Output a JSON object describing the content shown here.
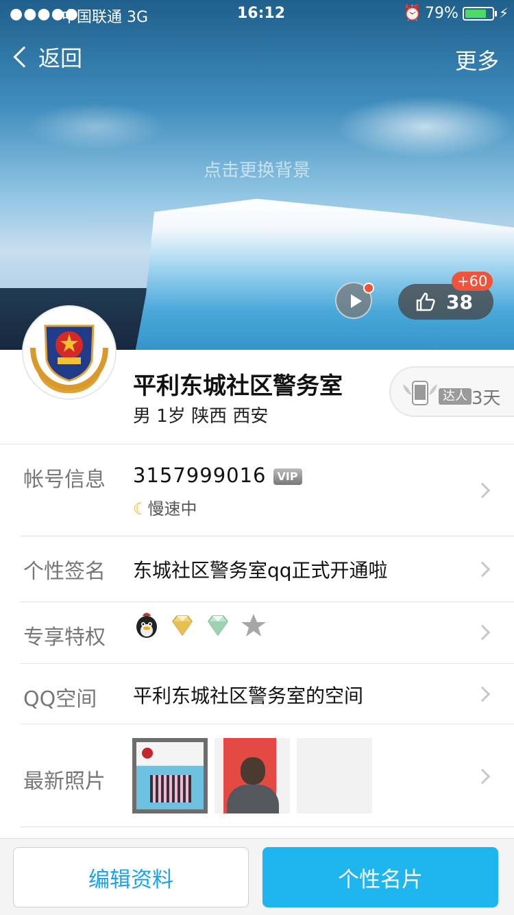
{
  "status_bar": {
    "signal": "●●●●●",
    "carrier": "中国联通   3G",
    "time": "16:12",
    "alarm_icon": "alarm-clock-icon",
    "battery_percent": "79%",
    "battery_level": 0.79
  },
  "nav": {
    "back_label": "返回",
    "more_label": "更多"
  },
  "cover": {
    "hint": "点击更换背景",
    "like_count": "38",
    "like_badge": "+60"
  },
  "profile": {
    "name": "平利东城社区警务室",
    "meta": "男   1岁   陕西 西安",
    "daren_tag": "达人",
    "daren_days": "3天"
  },
  "rows": {
    "account": {
      "label": "帐号信息",
      "qq_number": "3157999016",
      "vip": "VIP",
      "status": "慢速中"
    },
    "signature": {
      "label": "个性签名",
      "value": "东城社区警务室qq正式开通啦"
    },
    "privilege": {
      "label": "专享特权",
      "icons": [
        "qq-penguin-icon",
        "yellow-diamond-icon",
        "green-diamond-icon",
        "star-icon"
      ]
    },
    "qzone": {
      "label": "QQ空间",
      "value": "平利东城社区警务室的空间"
    },
    "photos": {
      "label": "最新照片"
    }
  },
  "bottom": {
    "edit_label": "编辑资料",
    "card_label": "个性名片"
  },
  "colors": {
    "accent": "#1fb5ef",
    "badge_red": "#f0533b",
    "battery_green": "#4cd964"
  }
}
